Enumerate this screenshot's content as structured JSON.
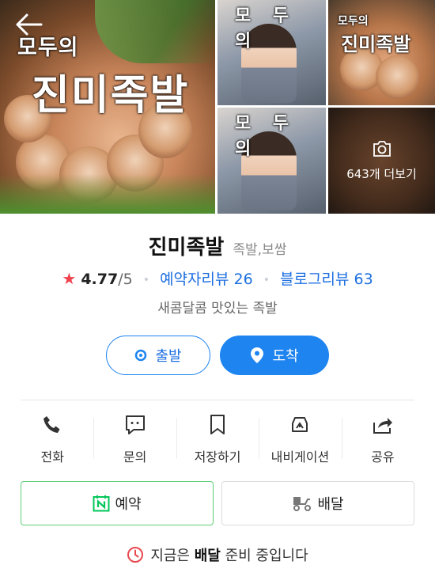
{
  "gallery": {
    "main_caption_small": "모두의",
    "main_caption_big": "진미족발",
    "tile_a_caption": "모 두 의",
    "tile_b_caption_small": "모두의",
    "tile_b_caption_big": "진미족발",
    "tile_c_caption": "모 두 의",
    "more_photos_label": "643개 더보기"
  },
  "place": {
    "name": "진미족발",
    "category": "족발,보쌈",
    "rating": "4.77",
    "rating_max": "/5",
    "visitor_review_label": "예약자리뷰 26",
    "blog_review_label": "블로그리뷰 63",
    "description": "새콤달콤 맛있는 족발"
  },
  "route": {
    "depart_label": "출발",
    "arrive_label": "도착"
  },
  "actions": [
    {
      "label": "전화",
      "icon": "phone-icon"
    },
    {
      "label": "문의",
      "icon": "chat-icon"
    },
    {
      "label": "저장하기",
      "icon": "bookmark-icon"
    },
    {
      "label": "내비게이션",
      "icon": "navigation-icon"
    },
    {
      "label": "공유",
      "icon": "share-icon"
    }
  ],
  "service": {
    "reserve_label": "예약",
    "delivery_label": "배달"
  },
  "status": {
    "prefix": "지금은",
    "highlight": "배달",
    "suffix": "준비 중입니다"
  },
  "colors": {
    "accent_blue": "#1d84f0",
    "link_blue": "#1d6fe0",
    "star_red": "#f0414d",
    "naver_green": "#03c75a",
    "clock_red": "#e8484f"
  }
}
